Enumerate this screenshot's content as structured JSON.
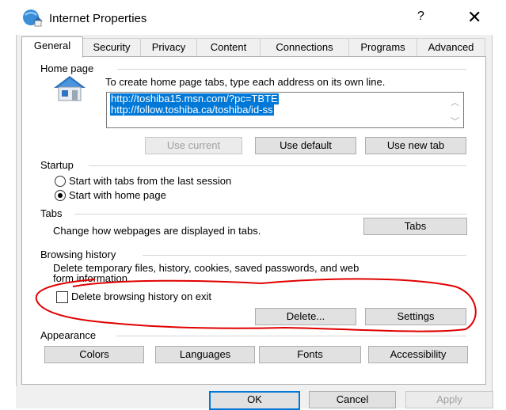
{
  "window": {
    "title": "Internet Properties",
    "help": "?",
    "close": "✕"
  },
  "tabs": [
    "General",
    "Security",
    "Privacy",
    "Content",
    "Connections",
    "Programs",
    "Advanced"
  ],
  "home_page": {
    "label": "Home page",
    "instruction": "To create home page tabs, type each address on its own line.",
    "urls": [
      "http://toshiba15.msn.com/?pc=TBTE",
      "http://follow.toshiba.ca/toshiba/id-ss"
    ],
    "use_current": "Use current",
    "use_default": "Use default",
    "use_new_tab": "Use new tab"
  },
  "startup": {
    "label": "Startup",
    "option1": "Start with tabs from the last session",
    "option2": "Start with home page",
    "selected": "option2"
  },
  "tabs_group": {
    "label": "Tabs",
    "text": "Change how webpages are displayed in tabs.",
    "button": "Tabs"
  },
  "browsing_history": {
    "label": "Browsing history",
    "text_line1": "Delete temporary files, history, cookies, saved passwords, and web",
    "text_line2": "form information.",
    "checkbox": "Delete browsing history on exit",
    "checked": false,
    "delete": "Delete...",
    "settings": "Settings"
  },
  "appearance": {
    "label": "Appearance",
    "colors": "Colors",
    "languages": "Languages",
    "fonts": "Fonts",
    "accessibility": "Accessibility"
  },
  "footer": {
    "ok": "OK",
    "cancel": "Cancel",
    "apply": "Apply"
  },
  "colors": {
    "annotation": "#e00000",
    "accent": "#0078d7"
  }
}
